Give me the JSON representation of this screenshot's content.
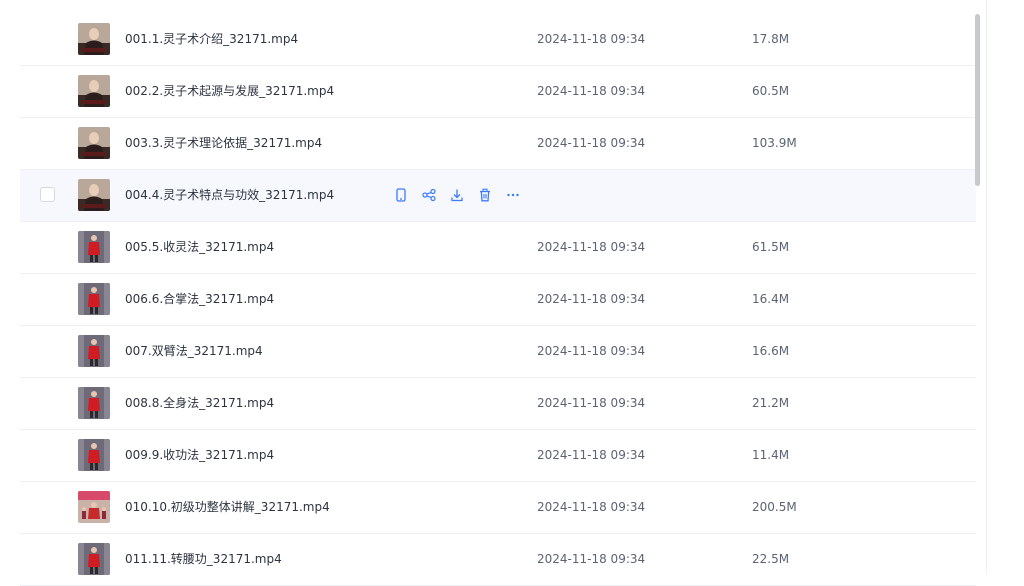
{
  "accent_color": "#3e7bfa",
  "hovered_row_index": 3,
  "hover_actions": [
    {
      "icon": "phone-icon"
    },
    {
      "icon": "share-icon"
    },
    {
      "icon": "download-icon"
    },
    {
      "icon": "trash-icon"
    },
    {
      "icon": "more-icon"
    }
  ],
  "files": [
    {
      "name": "001.1.灵子术介绍_32171.mp4",
      "date": "2024-11-18 09:34",
      "size": "17.8M",
      "thumb": "dark"
    },
    {
      "name": "002.2.灵子术起源与发展_32171.mp4",
      "date": "2024-11-18 09:34",
      "size": "60.5M",
      "thumb": "dark"
    },
    {
      "name": "003.3.灵子术理论依据_32171.mp4",
      "date": "2024-11-18 09:34",
      "size": "103.9M",
      "thumb": "dark"
    },
    {
      "name": "004.4.灵子术特点与功效_32171.mp4",
      "date": "",
      "size": "",
      "thumb": "dark"
    },
    {
      "name": "005.5.收灵法_32171.mp4",
      "date": "2024-11-18 09:34",
      "size": "61.5M",
      "thumb": "red"
    },
    {
      "name": "006.6.合掌法_32171.mp4",
      "date": "2024-11-18 09:34",
      "size": "16.4M",
      "thumb": "red"
    },
    {
      "name": "007.双臂法_32171.mp4",
      "date": "2024-11-18 09:34",
      "size": "16.6M",
      "thumb": "red"
    },
    {
      "name": "008.8.全身法_32171.mp4",
      "date": "2024-11-18 09:34",
      "size": "21.2M",
      "thumb": "red"
    },
    {
      "name": "009.9.收功法_32171.mp4",
      "date": "2024-11-18 09:34",
      "size": "11.4M",
      "thumb": "red"
    },
    {
      "name": "010.10.初级功整体讲解_32171.mp4",
      "date": "2024-11-18 09:34",
      "size": "200.5M",
      "thumb": "group"
    },
    {
      "name": "011.11.转腰功_32171.mp4",
      "date": "2024-11-18 09:34",
      "size": "22.5M",
      "thumb": "red"
    }
  ]
}
